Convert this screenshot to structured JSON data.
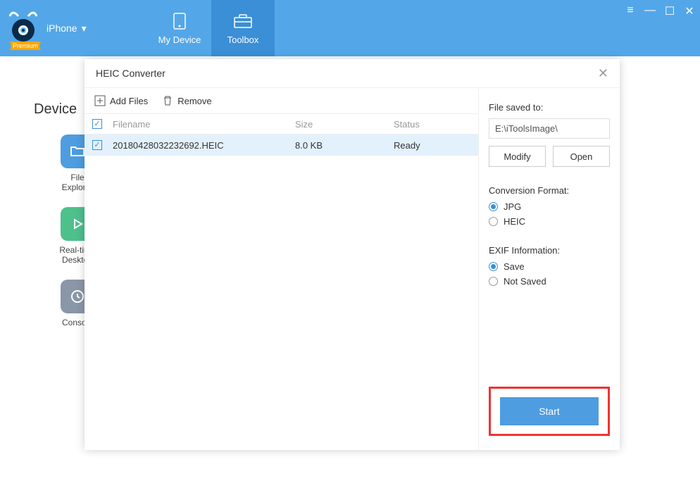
{
  "brand": {
    "premium": "Premium",
    "device": "iPhone"
  },
  "nav": {
    "my_device": "My Device",
    "toolbox": "Toolbox"
  },
  "bg": {
    "title": "Device",
    "tools": {
      "file_explorer": "File\nExplorer",
      "realtime_desktop": "Real-time\nDesktop",
      "console": "Console"
    }
  },
  "modal": {
    "title": "HEIC Converter",
    "toolbar": {
      "add_files": "Add Files",
      "remove": "Remove"
    },
    "columns": {
      "filename": "Filename",
      "size": "Size",
      "status": "Status"
    },
    "rows": [
      {
        "filename": "20180428032232692.HEIC",
        "size": "8.0 KB",
        "status": "Ready"
      }
    ],
    "right": {
      "saved_to_label": "File saved to:",
      "saved_to_path": "E:\\iToolsImage\\",
      "modify": "Modify",
      "open": "Open",
      "format_label": "Conversion Format:",
      "format_jpg": "JPG",
      "format_heic": "HEIC",
      "exif_label": "EXIF Information:",
      "exif_save": "Save",
      "exif_not": "Not Saved",
      "start": "Start"
    }
  }
}
